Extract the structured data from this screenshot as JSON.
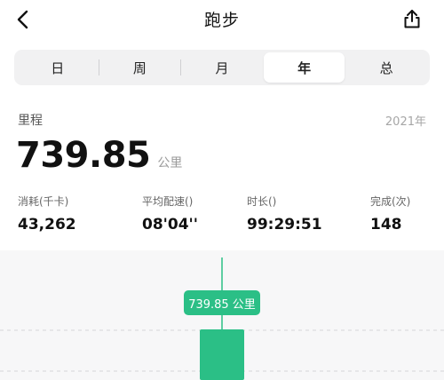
{
  "header": {
    "title": "跑步",
    "back_icon": "chevron-left-icon",
    "share_icon": "share-icon"
  },
  "tabs": [
    {
      "label": "日",
      "active": false
    },
    {
      "label": "周",
      "active": false
    },
    {
      "label": "月",
      "active": false
    },
    {
      "label": "年",
      "active": true
    },
    {
      "label": "总",
      "active": false
    }
  ],
  "summary": {
    "label": "里程",
    "year": "2021年",
    "distance": "739.85",
    "unit": "公里"
  },
  "stats": [
    {
      "label": "消耗(千卡)",
      "value": "43,262"
    },
    {
      "label": "平均配速()",
      "value": "08'04''"
    },
    {
      "label": "时长()",
      "value": "99:29:51"
    },
    {
      "label": "完成(次)",
      "value": "148"
    }
  ],
  "chart": {
    "tooltip": "739.85 公里",
    "accent_color": "#2bbf86",
    "background_color": "#f7f7f8"
  },
  "chart_data": {
    "type": "bar",
    "categories": [
      "2021"
    ],
    "values": [
      739.85
    ],
    "selected_category": "2021"
  }
}
